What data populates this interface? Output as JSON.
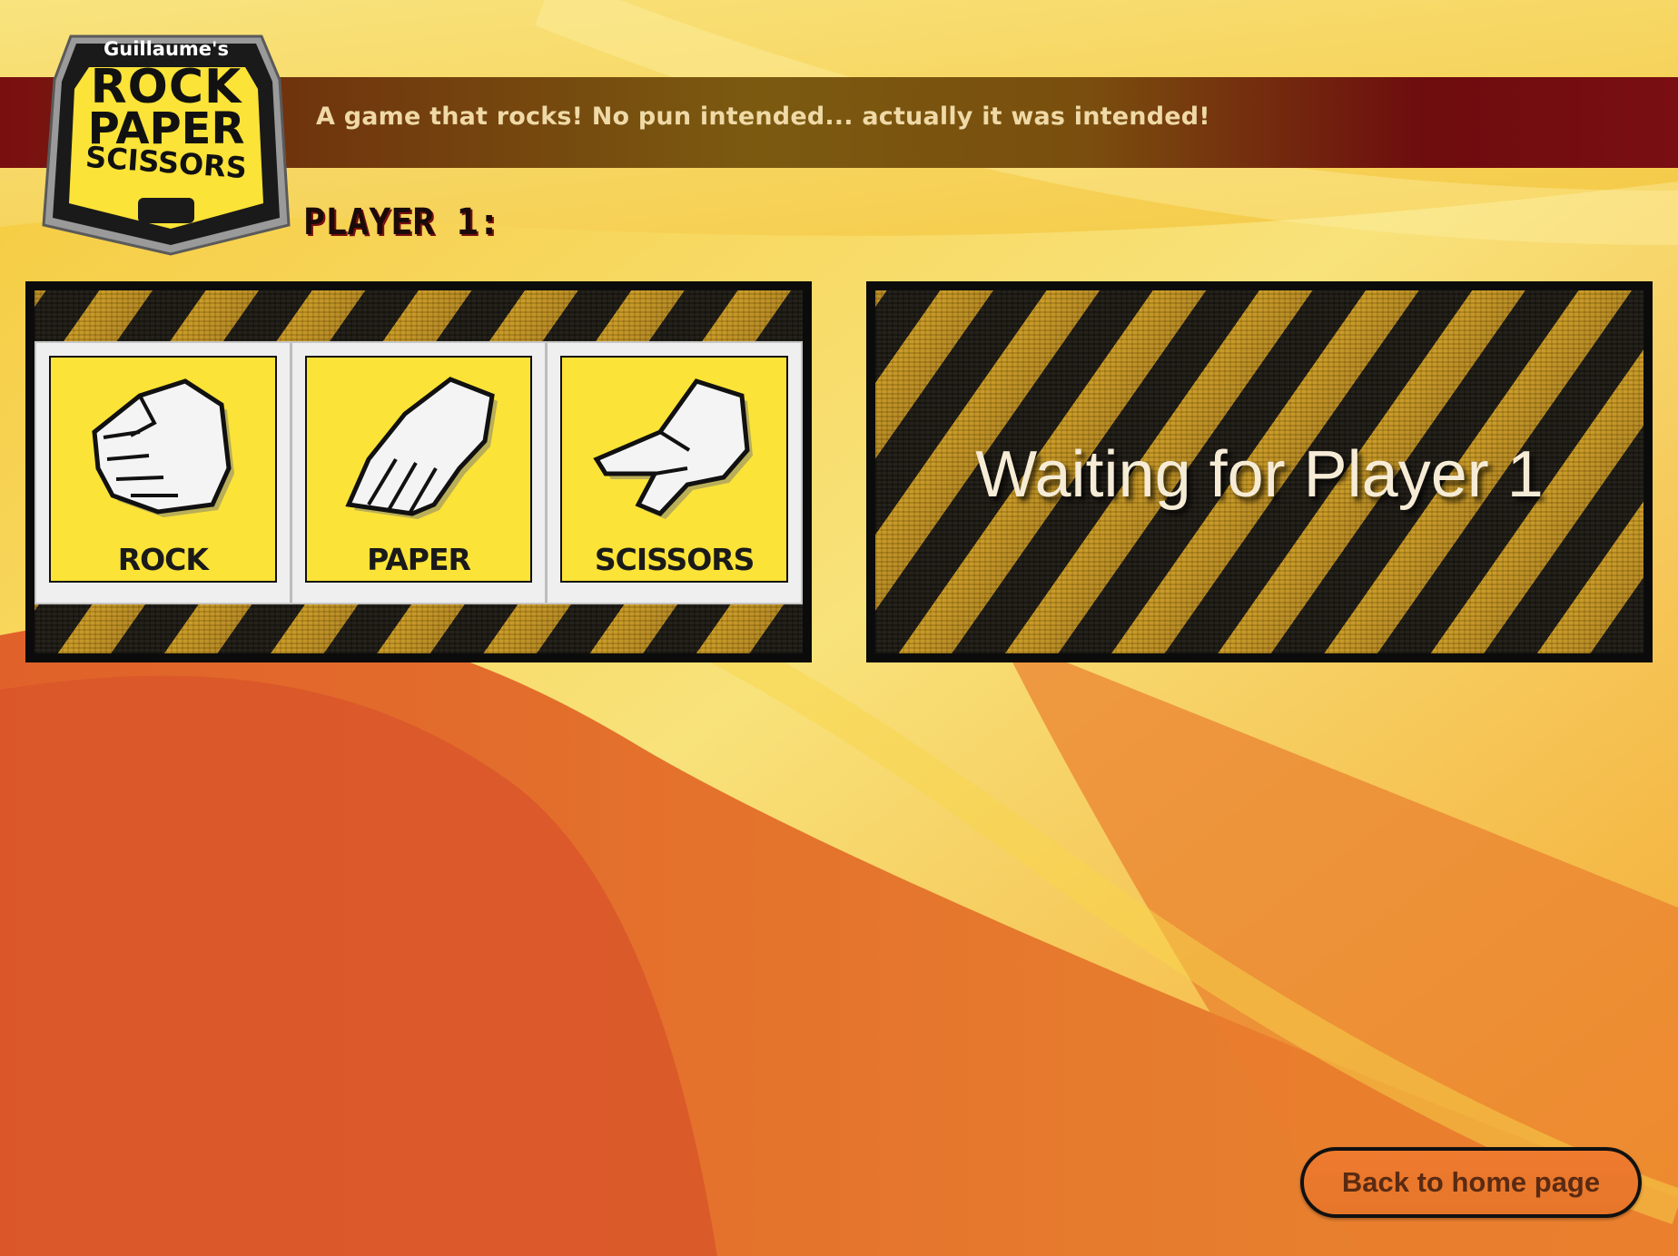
{
  "header": {
    "logo": {
      "owner": "Guillaume's",
      "words": [
        "ROCK",
        "PAPER",
        "SCISSORS"
      ]
    },
    "tagline": "A game that rocks! No pun intended... actually it was intended!"
  },
  "player": {
    "label": "PLAYER 1:"
  },
  "choices": [
    {
      "label": "ROCK",
      "icon": "rock-hand-icon"
    },
    {
      "label": "PAPER",
      "icon": "paper-hand-icon"
    },
    {
      "label": "SCISSORS",
      "icon": "scissors-hand-icon"
    }
  ],
  "status": {
    "text": "Waiting for Player 1"
  },
  "footer": {
    "back_label": "Back to home page"
  },
  "colors": {
    "banner": "#7a0e10",
    "choice_yellow": "#fbe337",
    "hazard_gold": "#c9981f",
    "hazard_black": "#1a1610",
    "background_orange": "#e8742c",
    "background_yellow": "#f7d23a"
  }
}
